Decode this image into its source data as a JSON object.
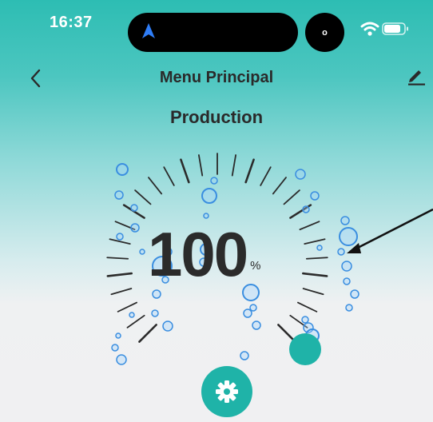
{
  "status_bar": {
    "time": "16:37",
    "indicator": "o",
    "icons": [
      "location-arrow-icon",
      "wifi-icon",
      "battery-icon"
    ]
  },
  "header": {
    "title": "Menu Principal",
    "back_icon": "chevron-left-icon",
    "edit_icon": "pencil-icon"
  },
  "section": {
    "title": "Production"
  },
  "gauge": {
    "value": "100",
    "unit": "%",
    "level_percent": 100
  },
  "settings": {
    "icon": "gear-icon"
  },
  "colors": {
    "accent": "#1fb3a8",
    "gradient_top": "#2dbdb3",
    "background_bottom": "#f0f0f2",
    "text": "#2b2b2b",
    "bubble": "#3a8ee0"
  }
}
